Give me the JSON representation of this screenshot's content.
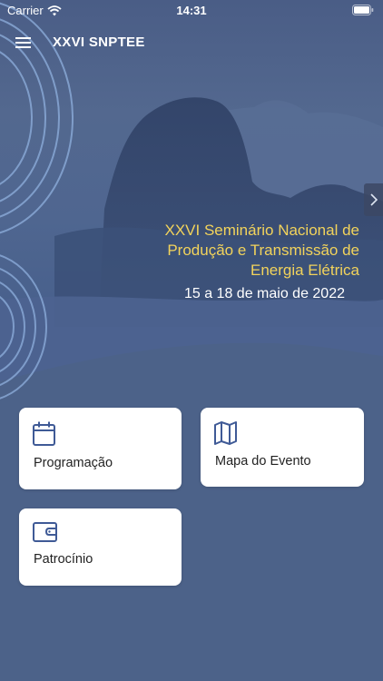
{
  "status_bar": {
    "carrier": "Carrier",
    "time": "14:31",
    "icons": [
      "wifi-icon",
      "battery-icon"
    ]
  },
  "nav": {
    "title": "XXVI SNPTEE",
    "menu_icon": "hamburger-menu-icon"
  },
  "hero": {
    "title_lines": [
      "XXVI Seminário Nacional de",
      "Produção e Transmissão de",
      "Energia Elétrica"
    ],
    "date": "15 a 18 de maio de 2022",
    "next_icon": "chevron-right-icon"
  },
  "menu_cards": [
    {
      "label": "Programação",
      "icon": "calendar-icon"
    },
    {
      "label": "Mapa do Evento",
      "icon": "map-icon"
    },
    {
      "label": "Patrocínio",
      "icon": "wallet-icon"
    }
  ],
  "colors": {
    "background": "#4c6289",
    "title_accent": "#f2d35b",
    "icon_blue": "#3f5a96",
    "card_bg": "#ffffff"
  }
}
